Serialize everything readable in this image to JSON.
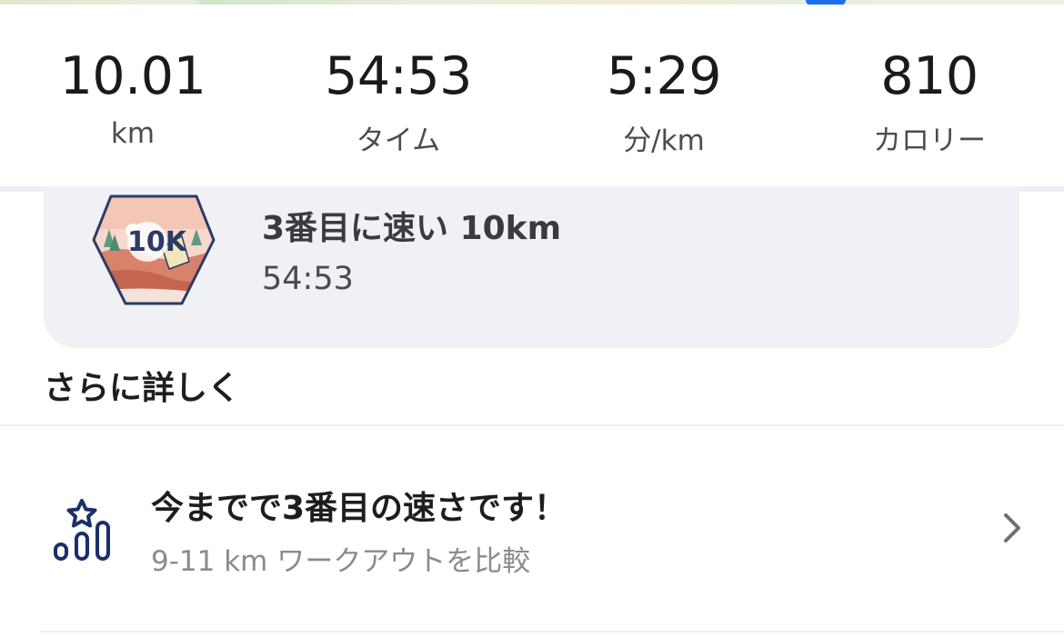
{
  "stats": [
    {
      "value": "10.01",
      "label": "km"
    },
    {
      "value": "54:53",
      "label": "タイム"
    },
    {
      "value": "5:29",
      "label": "分/km"
    },
    {
      "value": "810",
      "label": "カロリー"
    }
  ],
  "achievement": {
    "badge_text": "10K",
    "title": "3番目に速い 10km",
    "time": "54:53"
  },
  "more_details": {
    "title": "さらに詳しく"
  },
  "comparison": {
    "title": "今までで3番目の速さです！",
    "subtitle": "9-11 km ワークアウトを比較",
    "icon": "ranking-star-icon"
  },
  "colors": {
    "badge_navy": "#2c3a66",
    "badge_bg": "#f6d8cc",
    "card_bg": "#f0f1f5",
    "map_pin": "#1f6ef0"
  }
}
